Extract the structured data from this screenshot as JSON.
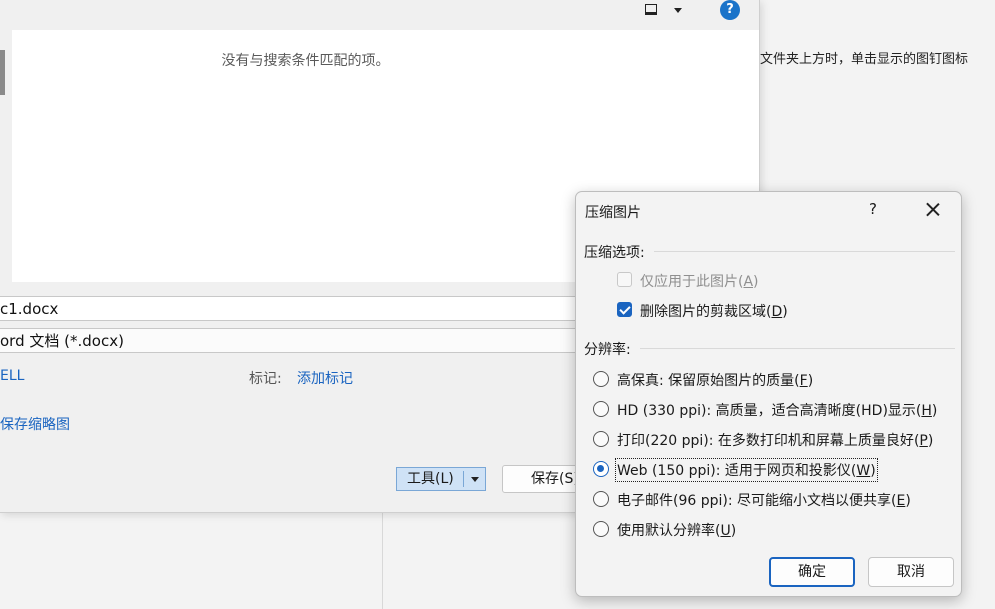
{
  "background": {
    "hint_text": "文件夹上方时，单击显示的图钉图标"
  },
  "save_dialog": {
    "empty_message": "没有与搜索条件匹配的项。",
    "help_icon_text": "?",
    "filename_value": "c1.docx",
    "filetype_value": "ord 文档 (*.docx)",
    "author_link": "ELL",
    "tags_label": "标记:",
    "tags_link": "添加标记",
    "save_thumbnail_link": "保存缩略图",
    "tools_button": "工具(L)",
    "save_button": "保存(S)"
  },
  "compress_dialog": {
    "title": "压缩图片",
    "help": "?",
    "section_options": "压缩选项:",
    "apply_only_label": "仅应用于此图片",
    "apply_only_key": "A",
    "apply_only_checked": false,
    "delete_crop_label": "删除图片的剪裁区域",
    "delete_crop_key": "D",
    "delete_crop_checked": true,
    "section_resolution": "分辨率:",
    "resolutions": [
      {
        "label": "高保真: 保留原始图片的质量",
        "key": "F",
        "selected": false
      },
      {
        "label": "HD (330 ppi): 高质量，适合高清晰度(HD)显示",
        "key": "H",
        "selected": false
      },
      {
        "label": "打印(220 ppi): 在多数打印机和屏幕上质量良好",
        "key": "P",
        "selected": false
      },
      {
        "label": "Web (150 ppi): 适用于网页和投影仪",
        "key": "W",
        "selected": true
      },
      {
        "label": "电子邮件(96 ppi): 尽可能缩小文档以便共享",
        "key": "E",
        "selected": false
      },
      {
        "label": "使用默认分辨率",
        "key": "U",
        "selected": false
      }
    ],
    "ok_button": "确定",
    "cancel_button": "取消",
    "accent_color": "#1a64c0"
  }
}
